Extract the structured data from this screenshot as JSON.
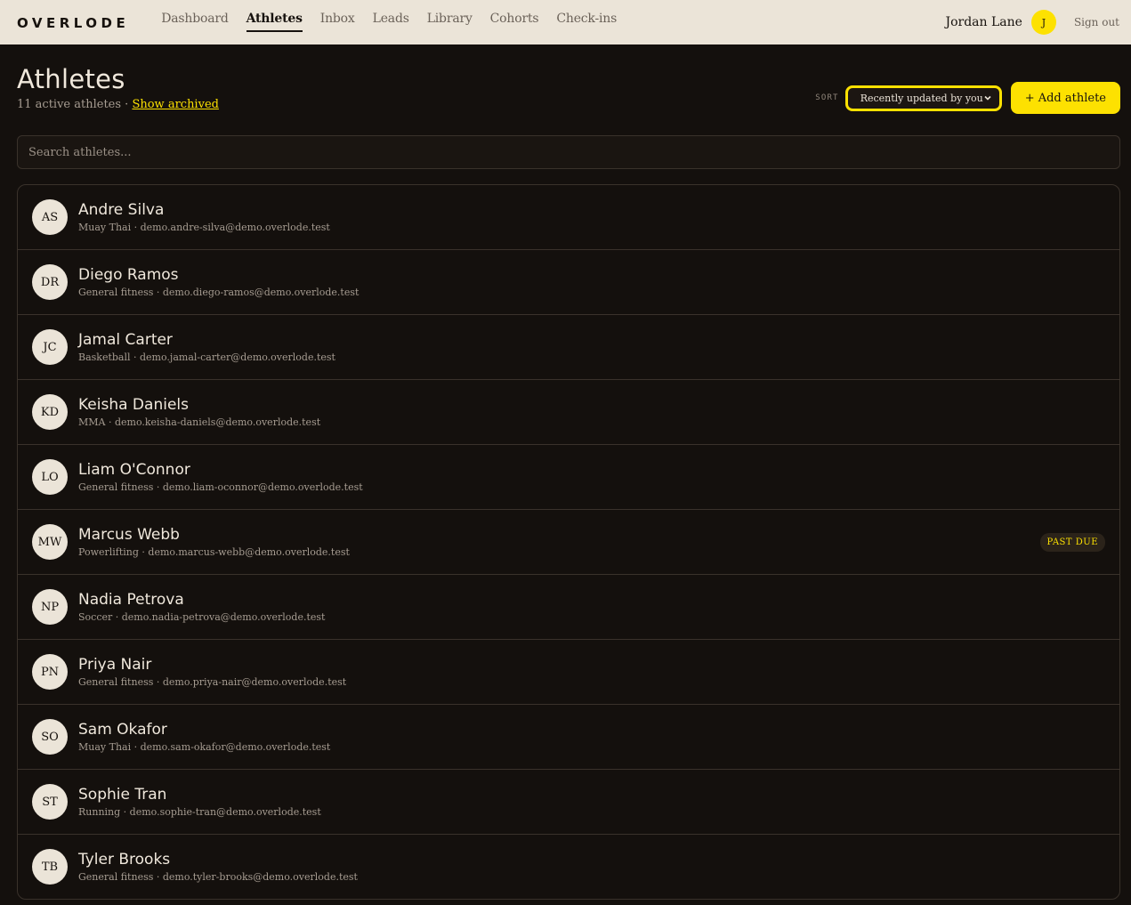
{
  "brand": "OVERLODE",
  "nav": [
    {
      "label": "Dashboard",
      "active": false
    },
    {
      "label": "Athletes",
      "active": true
    },
    {
      "label": "Inbox",
      "active": false
    },
    {
      "label": "Leads",
      "active": false
    },
    {
      "label": "Library",
      "active": false
    },
    {
      "label": "Cohorts",
      "active": false
    },
    {
      "label": "Check-ins",
      "active": false
    }
  ],
  "user": {
    "name": "Jordan Lane",
    "initial": "J",
    "signout": "Sign out"
  },
  "page": {
    "title": "Athletes",
    "count_text": "11 active athletes · ",
    "show_archived": "Show archived",
    "sort_label": "SORT",
    "sort_value": "Recently updated by you",
    "add_button": "+ Add athlete"
  },
  "search": {
    "placeholder": "Search athletes..."
  },
  "athletes": [
    {
      "initials": "AS",
      "name": "Andre Silva",
      "meta": "Muay Thai · demo.andre-silva@demo.overlode.test",
      "badge": ""
    },
    {
      "initials": "DR",
      "name": "Diego Ramos",
      "meta": "General fitness · demo.diego-ramos@demo.overlode.test",
      "badge": ""
    },
    {
      "initials": "JC",
      "name": "Jamal Carter",
      "meta": "Basketball · demo.jamal-carter@demo.overlode.test",
      "badge": ""
    },
    {
      "initials": "KD",
      "name": "Keisha Daniels",
      "meta": "MMA · demo.keisha-daniels@demo.overlode.test",
      "badge": ""
    },
    {
      "initials": "LO",
      "name": "Liam O'Connor",
      "meta": "General fitness · demo.liam-oconnor@demo.overlode.test",
      "badge": ""
    },
    {
      "initials": "MW",
      "name": "Marcus Webb",
      "meta": "Powerlifting · demo.marcus-webb@demo.overlode.test",
      "badge": "PAST DUE"
    },
    {
      "initials": "NP",
      "name": "Nadia Petrova",
      "meta": "Soccer · demo.nadia-petrova@demo.overlode.test",
      "badge": ""
    },
    {
      "initials": "PN",
      "name": "Priya Nair",
      "meta": "General fitness · demo.priya-nair@demo.overlode.test",
      "badge": ""
    },
    {
      "initials": "SO",
      "name": "Sam Okafor",
      "meta": "Muay Thai · demo.sam-okafor@demo.overlode.test",
      "badge": ""
    },
    {
      "initials": "ST",
      "name": "Sophie Tran",
      "meta": "Running · demo.sophie-tran@demo.overlode.test",
      "badge": ""
    },
    {
      "initials": "TB",
      "name": "Tyler Brooks",
      "meta": "General fitness · demo.tyler-brooks@demo.overlode.test",
      "badge": ""
    }
  ],
  "colors": {
    "accent": "#fde101",
    "background": "#14100d",
    "topbar": "#ebe4d8"
  },
  "icons": {
    "sort_dropdown": "chevron-down-icon"
  }
}
